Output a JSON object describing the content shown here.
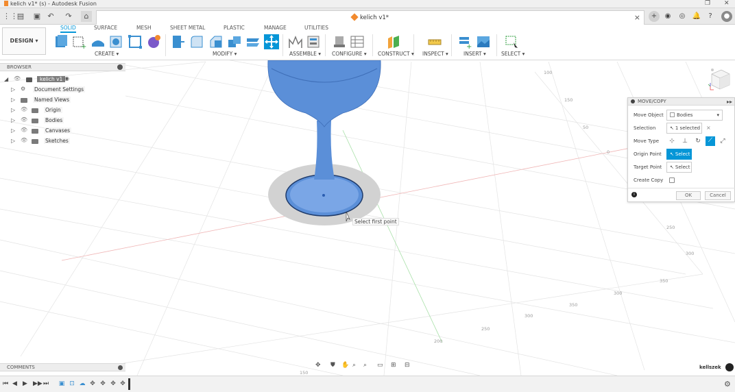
{
  "window": {
    "title": "kelich v1* (s) - Autodesk Fusion"
  },
  "document_tab": {
    "name": "kelich v1*"
  },
  "ribbon": {
    "workspace": "DESIGN ▾",
    "tabs": [
      "SOLID",
      "SURFACE",
      "MESH",
      "SHEET METAL",
      "PLASTIC",
      "MANAGE",
      "UTILITIES"
    ],
    "active_tab": "SOLID",
    "groups": [
      "CREATE ▾",
      "MODIFY ▾",
      "ASSEMBLE ▾",
      "CONFIGURE ▾",
      "CONSTRUCT ▾",
      "INSPECT ▾",
      "INSERT ▾",
      "SELECT ▾"
    ],
    "accent_color": "#0696d7"
  },
  "browser": {
    "title": "BROWSER",
    "root": "kelich v1",
    "items": [
      "Document Settings",
      "Named Views",
      "Origin",
      "Bodies",
      "Canvases",
      "Sketches"
    ]
  },
  "viewport": {
    "tooltip": "Select first point",
    "grid_labels": [
      "100",
      "150",
      "50",
      "0",
      "250",
      "300",
      "350",
      "300",
      "350",
      "300",
      "250",
      "200",
      "150"
    ],
    "model_color": "#5b8fd8"
  },
  "panel": {
    "title": "MOVE/COPY",
    "move_object_label": "Move Object",
    "move_object_value": "Bodies",
    "selection_label": "Selection",
    "selection_value": "1 selected",
    "move_type_label": "Move Type",
    "origin_point_label": "Origin Point",
    "origin_point_value": "Select",
    "target_point_label": "Target Point",
    "target_point_value": "Select",
    "create_copy_label": "Create Copy",
    "ok_label": "OK",
    "cancel_label": "Cancel"
  },
  "comments": {
    "title": "COMMENTS"
  },
  "user": {
    "name": "kellszek"
  }
}
